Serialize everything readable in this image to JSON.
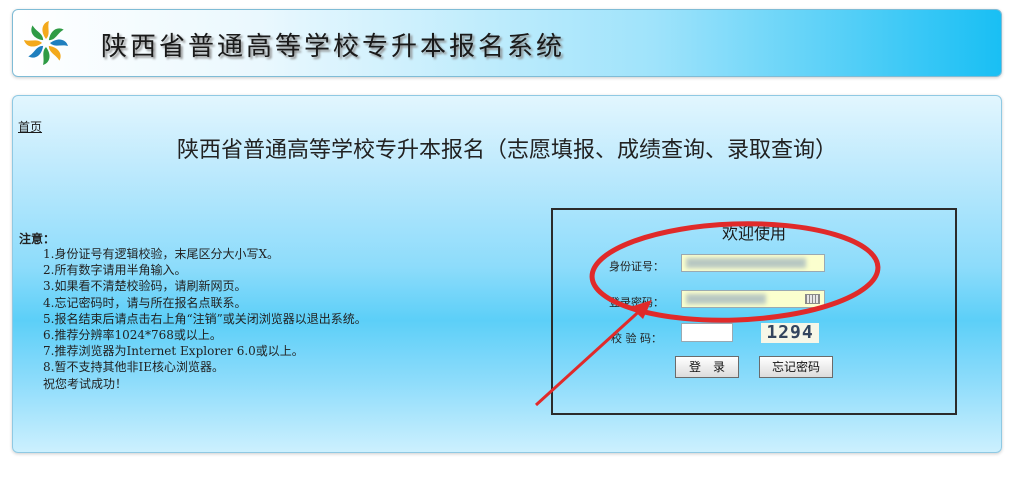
{
  "header": {
    "system_title": "陕西省普通高等学校专升本报名系统"
  },
  "nav": {
    "home_link": "首页"
  },
  "main": {
    "title": "陕西省普通高等学校专升本报名（志愿填报、成绩查询、录取查询）"
  },
  "notes": {
    "heading": "注意：",
    "items": [
      "1.身份证号有逻辑校验，末尾区分大小写X。",
      "2.所有数字请用半角输入。",
      "3.如果看不清楚校验码，请刷新网页。",
      "4.忘记密码时，请与所在报名点联系。",
      "5.报名结束后请点击右上角“注销”或关闭浏览器以退出系统。",
      "6.推荐分辨率1024*768或以上。",
      "7.推荐浏览器为Internet Explorer 6.0或以上。",
      "8.暂不支持其他非IE核心浏览器。",
      "祝您考试成功！"
    ]
  },
  "login": {
    "welcome": "欢迎使用",
    "id_label": "身份证号：",
    "password_label": "登录密码：",
    "captcha_label": "校 验 码：",
    "captcha_text": "1294",
    "login_button": "登　录",
    "forgot_button": "忘记密码"
  },
  "annotation_color": "#e02a2a"
}
